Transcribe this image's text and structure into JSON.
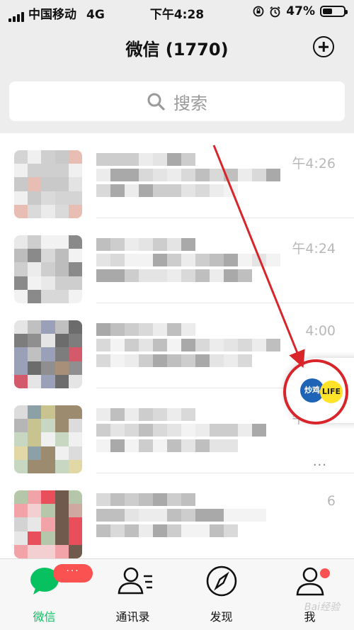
{
  "status_bar": {
    "carrier": "中国移动",
    "network": "4G",
    "time": "下午4:28",
    "battery_percent": "47%",
    "battery_level": 0.47
  },
  "nav": {
    "title": "微信 (1770)",
    "add_icon": "plus-circle-icon"
  },
  "search": {
    "label": "搜索",
    "icon": "search-icon"
  },
  "chats": [
    {
      "time": "午4:26"
    },
    {
      "time": "午4:24"
    },
    {
      "time": "4:00",
      "more": "···"
    },
    {
      "time": "午3:34",
      "more": "···"
    },
    {
      "time": "6"
    }
  ],
  "floating_window": {
    "icon1_text": "炒鸡",
    "icon2_text": "LIFE"
  },
  "tab_bar": {
    "tabs": [
      {
        "label": "微信",
        "icon": "chat-bubble-icon",
        "active": true
      },
      {
        "label": "通讯录",
        "icon": "contacts-icon"
      },
      {
        "label": "发现",
        "icon": "compass-icon"
      },
      {
        "label": "我",
        "icon": "person-icon"
      }
    ],
    "badge": "···",
    "accent_color": "#07c160",
    "badge_color": "#fa5151"
  },
  "watermark": "Bai经验"
}
